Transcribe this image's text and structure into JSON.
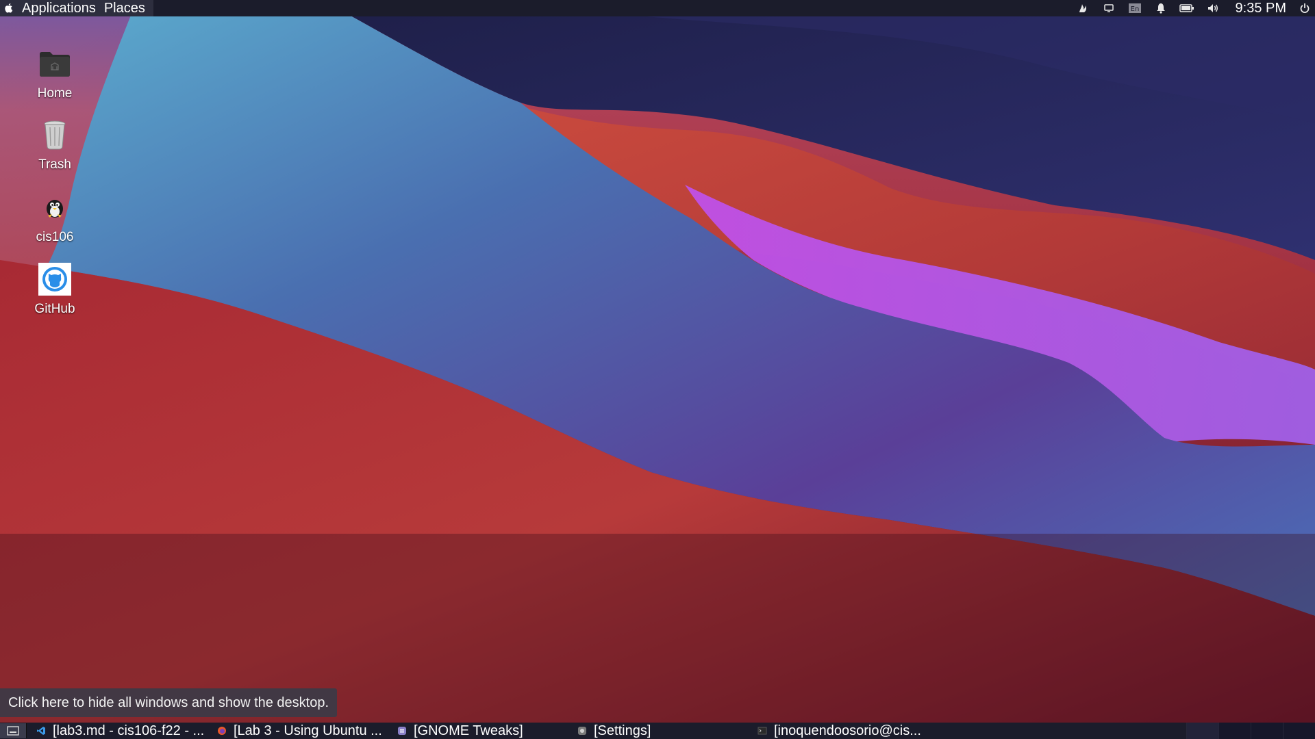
{
  "top_panel": {
    "menu": [
      {
        "label": "Applications"
      },
      {
        "label": "Places"
      }
    ],
    "tray_icons": [
      "flame-icon",
      "screen-icon",
      "keyboard-layout-icon",
      "bell-icon",
      "battery-icon",
      "volume-icon"
    ],
    "keyboard_layout": "En",
    "clock": "9:35 PM",
    "power_icon": "power-icon"
  },
  "desktop": {
    "icons": [
      {
        "label": "Home",
        "icon": "folder-home-icon"
      },
      {
        "label": "Trash",
        "icon": "trash-icon"
      },
      {
        "label": "cis106",
        "icon": "tux-icon"
      },
      {
        "label": "GitHub",
        "icon": "github-icon"
      }
    ]
  },
  "tooltip": {
    "text": "Click here to hide all windows and show the desktop."
  },
  "taskbar": {
    "show_desktop_icon": "show-desktop-icon",
    "tasks": [
      {
        "label": "[lab3.md - cis106-f22 - ...",
        "icon": "vscode-icon"
      },
      {
        "label": "[Lab 3 - Using Ubuntu ...",
        "icon": "firefox-icon"
      },
      {
        "label": "[GNOME Tweaks]",
        "icon": "tweaks-icon"
      },
      {
        "label": "[Settings]",
        "icon": "settings-icon"
      },
      {
        "label": "[inoquendoosorio@cis...",
        "icon": "terminal-icon"
      }
    ],
    "workspaces": 4
  },
  "colors": {
    "panel_bg": "#1b1c2b",
    "wallpaper_blue": "#5aa0c8",
    "wallpaper_red": "#c0403a",
    "wallpaper_purple": "#a055e0",
    "wallpaper_navy": "#202048"
  }
}
